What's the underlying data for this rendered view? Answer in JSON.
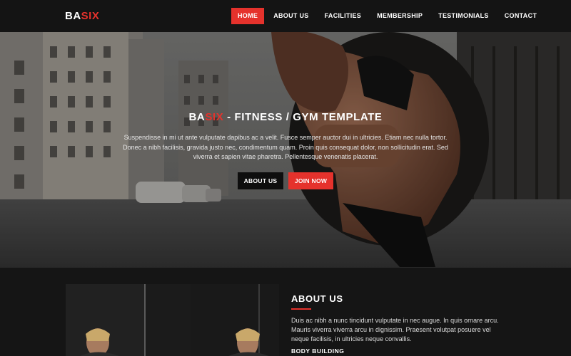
{
  "logo": {
    "part1": "BA",
    "part2": "SIX"
  },
  "nav": {
    "items": [
      {
        "label": "HOME"
      },
      {
        "label": "ABOUT US"
      },
      {
        "label": "FACILITIES"
      },
      {
        "label": "MEMBERSHIP"
      },
      {
        "label": "TESTIMONIALS"
      },
      {
        "label": "CONTACT"
      }
    ],
    "active_index": 0
  },
  "hero": {
    "title_part1": "BA",
    "title_part2": "SIX",
    "title_rest": " - FITNESS / GYM TEMPLATE",
    "text": "Suspendisse in mi ut ante vulputate dapibus ac a velit. Fusce semper auctor dui in ultricies. Etiam nec nulla tortor. Donec a nibh facilisis, gravida justo nec, condimentum quam. Proin quis consequat dolor, non sollicitudin erat. Sed viverra et sapien vitae pharetra. Pellentesque venenatis placerat.",
    "button_about": "ABOUT US",
    "button_join": "JOIN NOW"
  },
  "about": {
    "title": "ABOUT US",
    "text": "Duis ac nibh a nunc tincidunt vulputate in nec augue. In quis ornare arcu. Mauris viverra viverra arcu in dignissim. Praesent volutpat posuere vel neque facilisis, in ultricies neque convallis.",
    "subheading": "BODY BUILDING"
  },
  "colors": {
    "accent": "#e5322c",
    "background": "#141414",
    "section_bg": "#151515"
  }
}
